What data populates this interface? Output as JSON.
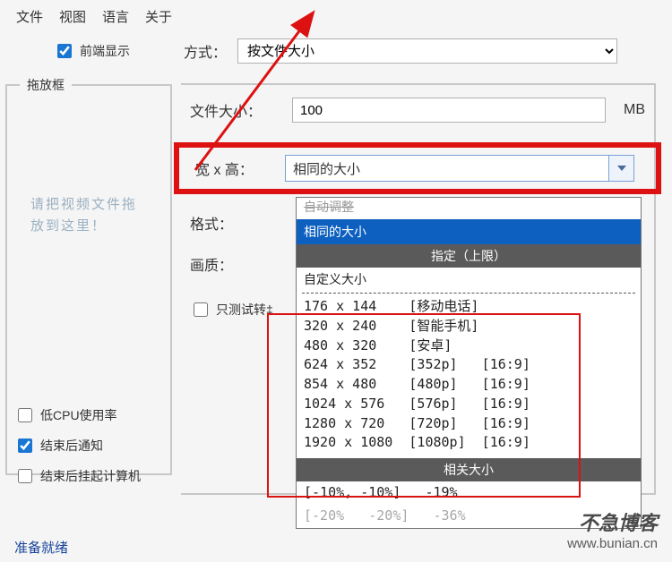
{
  "menu": {
    "file": "文件",
    "view": "视图",
    "lang": "语言",
    "about": "关于"
  },
  "topbar": {
    "front_display": "前端显示",
    "method_label": "方式：",
    "method_value": "按文件大小"
  },
  "dragbox": {
    "title": "拖放框",
    "hint_l1": "请把视频文件拖",
    "hint_l2": "放到这里！"
  },
  "sidebar": {
    "low_cpu": "低CPU使用率",
    "notify_end": "结束后通知",
    "shutdown_end": "结束后挂起计算机"
  },
  "fields": {
    "file_size_label": "文件大小：",
    "file_size_value": "100",
    "file_size_unit": "MB",
    "wh_label": "宽 x 高：",
    "wh_value": "相同的大小",
    "format_label": "格式：",
    "quality_label": "画质：",
    "only_test_label": "只测试转‡"
  },
  "dropdown": {
    "cut_top": "自动调整",
    "selected": "相同的大小",
    "header_upper": "指定（上限）",
    "custom": "自定义大小",
    "sizes": [
      "176 x 144    [移动电话]",
      "320 x 240    [智能手机]",
      "480 x 320    [安卓]",
      "624 x 352    [352p]   [16:9]",
      "854 x 480    [480p]   [16:9]",
      "1024 x 576   [576p]   [16:9]",
      "1280 x 720   [720p]   [16:9]",
      "1920 x 1080  [1080p]  [16:9]"
    ],
    "header_related": "相关大小",
    "bottom_partial": "[-10%, -10%]   -19%",
    "bottom_partial2": "[-20%   -20%]   -36%"
  },
  "status": "准备就绪",
  "watermark": {
    "title": "不急博客",
    "url": "www.bunian.cn"
  }
}
